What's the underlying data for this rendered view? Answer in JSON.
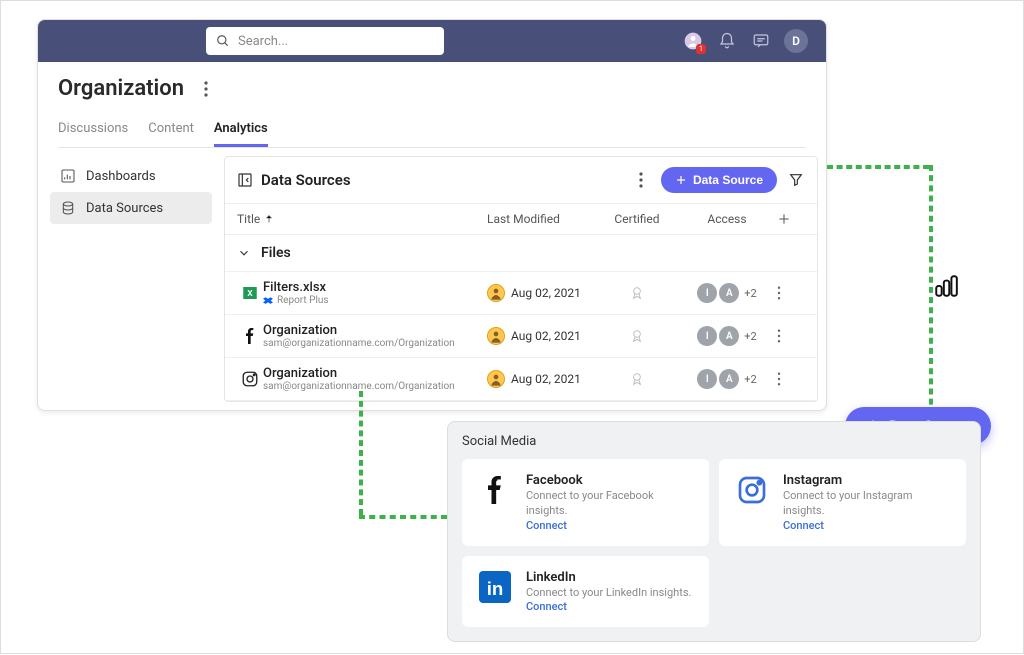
{
  "topbar": {
    "search_placeholder": "Search...",
    "avatar_letter": "D",
    "badge": "1"
  },
  "page": {
    "title": "Organization",
    "tabs": [
      "Discussions",
      "Content",
      "Analytics"
    ],
    "active_tab": 2
  },
  "sidebar": {
    "items": [
      {
        "label": "Dashboards"
      },
      {
        "label": "Data Sources"
      }
    ],
    "selected": 1
  },
  "panel": {
    "title": "Data Sources",
    "add_button": "Data Source",
    "columns": {
      "title": "Title",
      "modified": "Last Modified",
      "certified": "Certified",
      "access": "Access"
    },
    "group": "Files",
    "rows": [
      {
        "icon": "excel",
        "title": "Filters.xlsx",
        "sub_icon": "dropbox",
        "sub": "Report Plus",
        "modified": "Aug 02, 2021",
        "access_chips": [
          "I",
          "A"
        ],
        "access_more": "+2"
      },
      {
        "icon": "facebook",
        "title": "Organization",
        "sub": "sam@organizationname.com/Organization",
        "modified": "Aug 02, 2021",
        "access_chips": [
          "I",
          "A"
        ],
        "access_more": "+2"
      },
      {
        "icon": "instagram",
        "title": "Organization",
        "sub": "sam@organizationname.com/Organization",
        "modified": "Aug 02, 2021",
        "access_chips": [
          "I",
          "A"
        ],
        "access_more": "+2"
      }
    ]
  },
  "float_button": "Data Source",
  "social": {
    "title": "Social Media",
    "cards": [
      {
        "icon": "facebook",
        "name": "Facebook",
        "desc": "Connect to your Facebook insights.",
        "connect": "Connect"
      },
      {
        "icon": "instagram",
        "name": "Instagram",
        "desc": "Connect to your Instagram insights.",
        "connect": "Connect"
      },
      {
        "icon": "linkedin",
        "name": "LinkedIn",
        "desc": "Connect to your LinkedIn insights.",
        "connect": "Connect"
      }
    ]
  }
}
